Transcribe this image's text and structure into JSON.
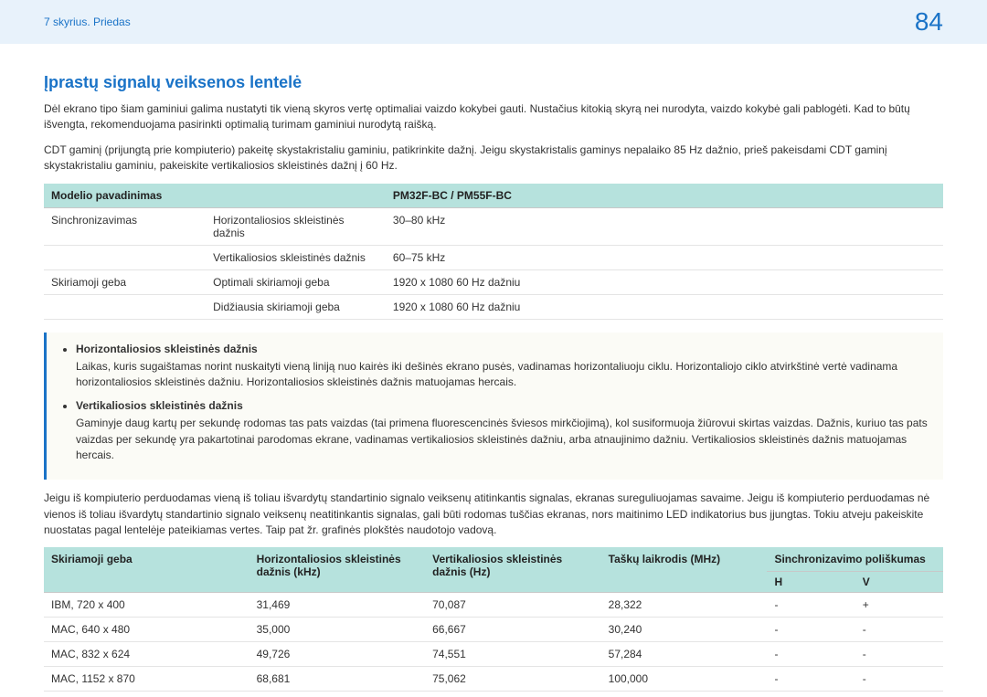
{
  "header": {
    "breadcrumb": "7 skyrius. Priedas",
    "page_number": "84"
  },
  "title": "Įprastų signalų veiksenos lentelė",
  "intro_paragraphs": [
    "Dėl ekrano tipo šiam gaminiui galima nustatyti tik vieną skyros vertę optimaliai vaizdo kokybei gauti. Nustačius kitokią skyrą nei nurodyta, vaizdo kokybė gali pablogėti. Kad to būtų išvengta, rekomenduojama pasirinkti optimalią turimam gaminiui nurodytą raišką.",
    "CDT gaminį (prijungtą prie kompiuterio) pakeitę skystakristaliu gaminiu, patikrinkite dažnį. Jeigu skystakristalis gaminys nepalaiko 85 Hz dažnio, prieš pakeisdami CDT gaminį skystakristaliu gaminiu, pakeiskite vertikaliosios skleistinės dažnį į 60 Hz."
  ],
  "spec_table": {
    "header": {
      "col1": "Modelio pavadinimas",
      "col2": "PM32F-BC / PM55F-BC"
    },
    "rows": [
      {
        "c1": "Sinchronizavimas",
        "c2": "Horizontaliosios skleistinės dažnis",
        "c3": "30–80 kHz"
      },
      {
        "c1": "",
        "c2": "Vertikaliosios skleistinės dažnis",
        "c3": "60–75 kHz"
      },
      {
        "c1": "Skiriamoji geba",
        "c2": "Optimali skiriamoji geba",
        "c3": "1920 x 1080 60 Hz dažniu"
      },
      {
        "c1": "",
        "c2": "Didžiausia skiriamoji geba",
        "c3": "1920 x 1080 60 Hz dažniu"
      }
    ]
  },
  "notes": [
    {
      "label": "Horizontaliosios skleistinės dažnis",
      "text": "Laikas, kuris sugaištamas norint nuskaityti vieną liniją nuo kairės iki dešinės ekrano pusės, vadinamas horizontaliuoju ciklu. Horizontaliojo ciklo atvirkštinė vertė vadinama horizontaliosios skleistinės dažniu. Horizontaliosios skleistinės dažnis matuojamas hercais."
    },
    {
      "label": "Vertikaliosios skleistinės dažnis",
      "text": "Gaminyje daug kartų per sekundę rodomas tas pats vaizdas (tai primena fluorescencinės šviesos mirkčiojimą), kol susiformuoja žiūrovui skirtas vaizdas. Dažnis, kuriuo tas pats vaizdas per sekundę yra pakartotinai parodomas ekrane, vadinamas vertikaliosios skleistinės dažniu, arba atnaujinimo dažniu. Vertikaliosios skleistinės dažnis matuojamas hercais."
    }
  ],
  "after_note_paragraph": "Jeigu iš kompiuterio perduodamas vieną iš toliau išvardytų standartinio signalo veiksenų atitinkantis signalas, ekranas sureguliuojamas savaime. Jeigu iš kompiuterio perduodamas nė vienos iš toliau išvardytų standartinio signalo veiksenų neatitinkantis signalas, gali būti rodomas tuščias ekranas, nors maitinimo LED indikatorius bus įjungtas. Tokiu atveju pakeiskite nuostatas pagal lentelėje pateikiamas vertes. Taip pat žr. grafinės plokštės naudotojo vadovą.",
  "timing_table": {
    "headers": {
      "res": "Skiriamoji geba",
      "hf": "Horizontaliosios skleistinės dažnis (kHz)",
      "vf": "Vertikaliosios skleistinės dažnis (Hz)",
      "pc": "Taškų laikrodis (MHz)",
      "pol": "Sinchronizavimo poliškumas",
      "polH": "H",
      "polV": "V"
    },
    "rows": [
      {
        "res": "IBM, 720 x 400",
        "hf": "31,469",
        "vf": "70,087",
        "pc": "28,322",
        "h": "-",
        "v": "+"
      },
      {
        "res": "MAC, 640 x 480",
        "hf": "35,000",
        "vf": "66,667",
        "pc": "30,240",
        "h": "-",
        "v": "-"
      },
      {
        "res": "MAC, 832 x 624",
        "hf": "49,726",
        "vf": "74,551",
        "pc": "57,284",
        "h": "-",
        "v": "-"
      },
      {
        "res": "MAC, 1152 x 870",
        "hf": "68,681",
        "vf": "75,062",
        "pc": "100,000",
        "h": "-",
        "v": "-"
      }
    ]
  }
}
